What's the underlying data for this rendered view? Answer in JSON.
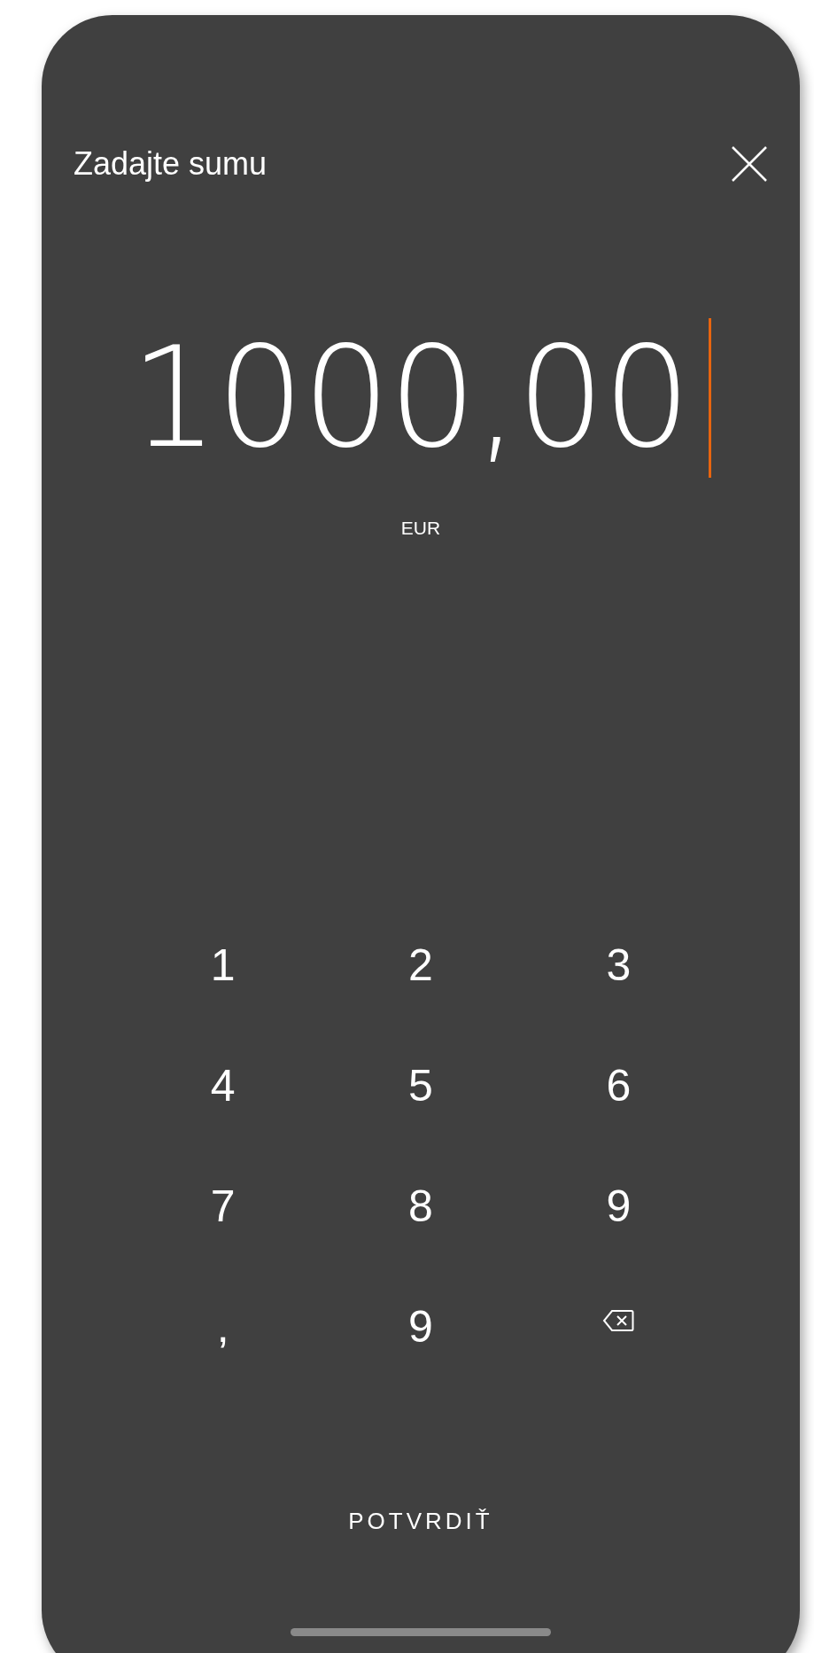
{
  "header": {
    "title": "Zadajte sumu"
  },
  "amount": {
    "value": "1000,00",
    "currency": "EUR"
  },
  "keypad": [
    {
      "kind": "digit",
      "label": "1"
    },
    {
      "kind": "digit",
      "label": "2"
    },
    {
      "kind": "digit",
      "label": "3"
    },
    {
      "kind": "digit",
      "label": "4"
    },
    {
      "kind": "digit",
      "label": "5"
    },
    {
      "kind": "digit",
      "label": "6"
    },
    {
      "kind": "digit",
      "label": "7"
    },
    {
      "kind": "digit",
      "label": "8"
    },
    {
      "kind": "digit",
      "label": "9"
    },
    {
      "kind": "digit",
      "label": ","
    },
    {
      "kind": "digit",
      "label": "9"
    },
    {
      "kind": "backspace"
    }
  ],
  "confirm_button": {
    "label": "POTVRDIŤ"
  }
}
